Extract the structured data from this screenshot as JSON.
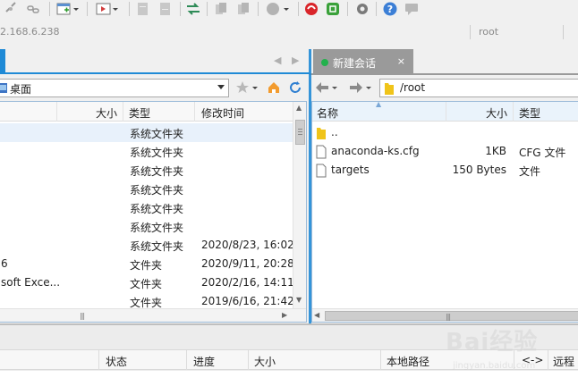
{
  "toolbar": {
    "buttons": [
      "disconnect-icon",
      "link-icon",
      "new-window-icon",
      "terminal-icon",
      "copy-icon",
      "paste-icon",
      "transfer-icon",
      "left-copy-icon",
      "right-copy-icon",
      "record-icon",
      "xshell-icon",
      "xftp-icon",
      "settings-icon",
      "help-icon",
      "chat-icon"
    ]
  },
  "address": {
    "host": "2.168.6.238",
    "user_placeholder": "root"
  },
  "left_pane": {
    "path": "桌面",
    "columns": [
      "大小",
      "类型",
      "修改时间"
    ],
    "rows": [
      {
        "name": "",
        "size": "",
        "type": "系统文件夹",
        "modified": ""
      },
      {
        "name": "",
        "size": "",
        "type": "系统文件夹",
        "modified": ""
      },
      {
        "name": "",
        "size": "",
        "type": "系统文件夹",
        "modified": ""
      },
      {
        "name": "",
        "size": "",
        "type": "系统文件夹",
        "modified": ""
      },
      {
        "name": "",
        "size": "",
        "type": "系统文件夹",
        "modified": ""
      },
      {
        "name": "",
        "size": "",
        "type": "系统文件夹",
        "modified": ""
      },
      {
        "name": "",
        "size": "",
        "type": "系统文件夹",
        "modified": "2020/8/23, 16:02"
      },
      {
        "name": "6",
        "size": "",
        "type": "文件夹",
        "modified": "2020/9/11, 20:28"
      },
      {
        "name": "soft Exce...",
        "size": "",
        "type": "文件夹",
        "modified": "2020/2/16, 14:11"
      },
      {
        "name": "",
        "size": "",
        "type": "文件夹",
        "modified": "2019/6/16, 21:42"
      }
    ]
  },
  "right_pane": {
    "tab_label": "新建会话",
    "tab_close": "×",
    "path": "/root",
    "columns": [
      "名称",
      "大小",
      "类型"
    ],
    "rows": [
      {
        "name": "..",
        "size": "",
        "type": "",
        "icon": "folder-icon"
      },
      {
        "name": "anaconda-ks.cfg",
        "size": "1KB",
        "type": "CFG 文件",
        "icon": "file-icon"
      },
      {
        "name": "targets",
        "size": "150 Bytes",
        "type": "文件",
        "icon": "file-icon"
      }
    ]
  },
  "queue": {
    "columns": [
      "状态",
      "进度",
      "大小",
      "本地路径",
      "<->",
      "远程路"
    ]
  },
  "watermark": {
    "text": "Bai经验",
    "sub": "jingyan.baidu.com"
  }
}
